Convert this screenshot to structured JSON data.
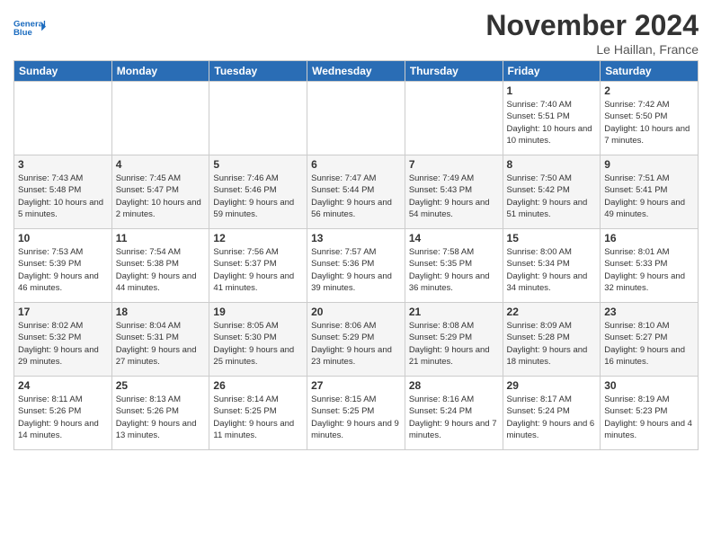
{
  "header": {
    "logo_line1": "General",
    "logo_line2": "Blue",
    "month_title": "November 2024",
    "location": "Le Haillan, France"
  },
  "days_of_week": [
    "Sunday",
    "Monday",
    "Tuesday",
    "Wednesday",
    "Thursday",
    "Friday",
    "Saturday"
  ],
  "weeks": [
    [
      {
        "day": "",
        "sunrise": "",
        "sunset": "",
        "daylight": ""
      },
      {
        "day": "",
        "sunrise": "",
        "sunset": "",
        "daylight": ""
      },
      {
        "day": "",
        "sunrise": "",
        "sunset": "",
        "daylight": ""
      },
      {
        "day": "",
        "sunrise": "",
        "sunset": "",
        "daylight": ""
      },
      {
        "day": "",
        "sunrise": "",
        "sunset": "",
        "daylight": ""
      },
      {
        "day": "1",
        "sunrise": "Sunrise: 7:40 AM",
        "sunset": "Sunset: 5:51 PM",
        "daylight": "Daylight: 10 hours and 10 minutes."
      },
      {
        "day": "2",
        "sunrise": "Sunrise: 7:42 AM",
        "sunset": "Sunset: 5:50 PM",
        "daylight": "Daylight: 10 hours and 7 minutes."
      }
    ],
    [
      {
        "day": "3",
        "sunrise": "Sunrise: 7:43 AM",
        "sunset": "Sunset: 5:48 PM",
        "daylight": "Daylight: 10 hours and 5 minutes."
      },
      {
        "day": "4",
        "sunrise": "Sunrise: 7:45 AM",
        "sunset": "Sunset: 5:47 PM",
        "daylight": "Daylight: 10 hours and 2 minutes."
      },
      {
        "day": "5",
        "sunrise": "Sunrise: 7:46 AM",
        "sunset": "Sunset: 5:46 PM",
        "daylight": "Daylight: 9 hours and 59 minutes."
      },
      {
        "day": "6",
        "sunrise": "Sunrise: 7:47 AM",
        "sunset": "Sunset: 5:44 PM",
        "daylight": "Daylight: 9 hours and 56 minutes."
      },
      {
        "day": "7",
        "sunrise": "Sunrise: 7:49 AM",
        "sunset": "Sunset: 5:43 PM",
        "daylight": "Daylight: 9 hours and 54 minutes."
      },
      {
        "day": "8",
        "sunrise": "Sunrise: 7:50 AM",
        "sunset": "Sunset: 5:42 PM",
        "daylight": "Daylight: 9 hours and 51 minutes."
      },
      {
        "day": "9",
        "sunrise": "Sunrise: 7:51 AM",
        "sunset": "Sunset: 5:41 PM",
        "daylight": "Daylight: 9 hours and 49 minutes."
      }
    ],
    [
      {
        "day": "10",
        "sunrise": "Sunrise: 7:53 AM",
        "sunset": "Sunset: 5:39 PM",
        "daylight": "Daylight: 9 hours and 46 minutes."
      },
      {
        "day": "11",
        "sunrise": "Sunrise: 7:54 AM",
        "sunset": "Sunset: 5:38 PM",
        "daylight": "Daylight: 9 hours and 44 minutes."
      },
      {
        "day": "12",
        "sunrise": "Sunrise: 7:56 AM",
        "sunset": "Sunset: 5:37 PM",
        "daylight": "Daylight: 9 hours and 41 minutes."
      },
      {
        "day": "13",
        "sunrise": "Sunrise: 7:57 AM",
        "sunset": "Sunset: 5:36 PM",
        "daylight": "Daylight: 9 hours and 39 minutes."
      },
      {
        "day": "14",
        "sunrise": "Sunrise: 7:58 AM",
        "sunset": "Sunset: 5:35 PM",
        "daylight": "Daylight: 9 hours and 36 minutes."
      },
      {
        "day": "15",
        "sunrise": "Sunrise: 8:00 AM",
        "sunset": "Sunset: 5:34 PM",
        "daylight": "Daylight: 9 hours and 34 minutes."
      },
      {
        "day": "16",
        "sunrise": "Sunrise: 8:01 AM",
        "sunset": "Sunset: 5:33 PM",
        "daylight": "Daylight: 9 hours and 32 minutes."
      }
    ],
    [
      {
        "day": "17",
        "sunrise": "Sunrise: 8:02 AM",
        "sunset": "Sunset: 5:32 PM",
        "daylight": "Daylight: 9 hours and 29 minutes."
      },
      {
        "day": "18",
        "sunrise": "Sunrise: 8:04 AM",
        "sunset": "Sunset: 5:31 PM",
        "daylight": "Daylight: 9 hours and 27 minutes."
      },
      {
        "day": "19",
        "sunrise": "Sunrise: 8:05 AM",
        "sunset": "Sunset: 5:30 PM",
        "daylight": "Daylight: 9 hours and 25 minutes."
      },
      {
        "day": "20",
        "sunrise": "Sunrise: 8:06 AM",
        "sunset": "Sunset: 5:29 PM",
        "daylight": "Daylight: 9 hours and 23 minutes."
      },
      {
        "day": "21",
        "sunrise": "Sunrise: 8:08 AM",
        "sunset": "Sunset: 5:29 PM",
        "daylight": "Daylight: 9 hours and 21 minutes."
      },
      {
        "day": "22",
        "sunrise": "Sunrise: 8:09 AM",
        "sunset": "Sunset: 5:28 PM",
        "daylight": "Daylight: 9 hours and 18 minutes."
      },
      {
        "day": "23",
        "sunrise": "Sunrise: 8:10 AM",
        "sunset": "Sunset: 5:27 PM",
        "daylight": "Daylight: 9 hours and 16 minutes."
      }
    ],
    [
      {
        "day": "24",
        "sunrise": "Sunrise: 8:11 AM",
        "sunset": "Sunset: 5:26 PM",
        "daylight": "Daylight: 9 hours and 14 minutes."
      },
      {
        "day": "25",
        "sunrise": "Sunrise: 8:13 AM",
        "sunset": "Sunset: 5:26 PM",
        "daylight": "Daylight: 9 hours and 13 minutes."
      },
      {
        "day": "26",
        "sunrise": "Sunrise: 8:14 AM",
        "sunset": "Sunset: 5:25 PM",
        "daylight": "Daylight: 9 hours and 11 minutes."
      },
      {
        "day": "27",
        "sunrise": "Sunrise: 8:15 AM",
        "sunset": "Sunset: 5:25 PM",
        "daylight": "Daylight: 9 hours and 9 minutes."
      },
      {
        "day": "28",
        "sunrise": "Sunrise: 8:16 AM",
        "sunset": "Sunset: 5:24 PM",
        "daylight": "Daylight: 9 hours and 7 minutes."
      },
      {
        "day": "29",
        "sunrise": "Sunrise: 8:17 AM",
        "sunset": "Sunset: 5:24 PM",
        "daylight": "Daylight: 9 hours and 6 minutes."
      },
      {
        "day": "30",
        "sunrise": "Sunrise: 8:19 AM",
        "sunset": "Sunset: 5:23 PM",
        "daylight": "Daylight: 9 hours and 4 minutes."
      }
    ]
  ]
}
